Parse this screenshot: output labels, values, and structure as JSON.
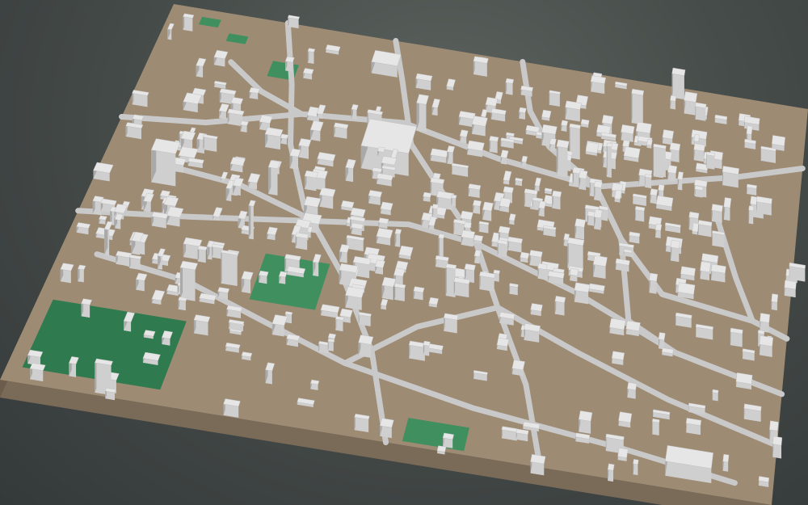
{
  "scene": {
    "kind": "3d-city-block-model",
    "colors": {
      "background": "#474d4a",
      "terrain_top": "#9e8b74",
      "terrain_side": "#7a6a58",
      "terrain_side_dark": "#6b5c4c",
      "road": "#c9c9c9",
      "building_top": "#e6e6e6",
      "building_side_light": "#cfcfcf",
      "building_side_dark": "#a9a9a9",
      "park": "#3f8f5f",
      "park_dark": "#2f7a4e"
    },
    "features": [
      {
        "type": "terrain-slab",
        "label": ""
      },
      {
        "type": "road-network",
        "label": ""
      },
      {
        "type": "buildings",
        "label": ""
      },
      {
        "type": "parks",
        "label": ""
      }
    ]
  }
}
